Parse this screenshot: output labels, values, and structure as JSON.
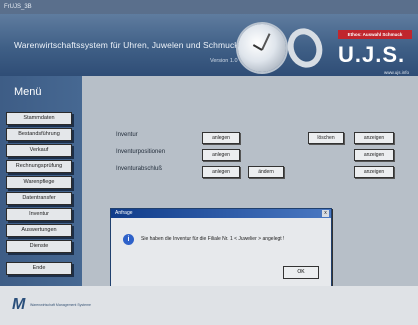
{
  "window": {
    "title": "FrUJS_3B"
  },
  "header": {
    "title": "Warenwirtschaftssystem für Uhren, Juwelen und Schmuck",
    "version": "Version 1.0",
    "badge": "Ethos: Auswahl Schmuck",
    "logo": "U.J.S.",
    "url": "www.ujs.info",
    "menu_title": "Menü"
  },
  "sidebar": {
    "items": [
      {
        "label": "Stammdaten"
      },
      {
        "label": "Bestandsführung"
      },
      {
        "label": "Verkauf"
      },
      {
        "label": "Rechnungsprüfung"
      },
      {
        "label": "Warenpflege"
      },
      {
        "label": "Datentransfer"
      },
      {
        "label": "Inventur"
      },
      {
        "label": "Auswertungen"
      },
      {
        "label": "Dienste"
      },
      {
        "label": "Ende"
      }
    ]
  },
  "main": {
    "rows": [
      {
        "label": "Inventur",
        "btn1": "anlegen",
        "btn2": "löschen",
        "btn3": "anzeigen"
      },
      {
        "label": "Inventurpositionen",
        "btn1": "anlegen",
        "btn3": "anzeigen"
      },
      {
        "label": "Inventurabschluß",
        "btn1": "anlegen",
        "btn2": "ändern",
        "btn3": "anzeigen"
      }
    ]
  },
  "dialog": {
    "title": "Anfrage",
    "close": "x",
    "message": "Sie haben die Inventur für die Filiale Nr. 1 < Juwelier > angelegt !",
    "ok": "OK"
  },
  "footer": {
    "logo_mark": "M",
    "logo_text": "Warenwirtschaft Management Systeme"
  },
  "colors": {
    "header": "#3f5f86",
    "sidebar": "#3e5d86",
    "badge": "#c0262d",
    "dialog_title": "#103c8a"
  }
}
